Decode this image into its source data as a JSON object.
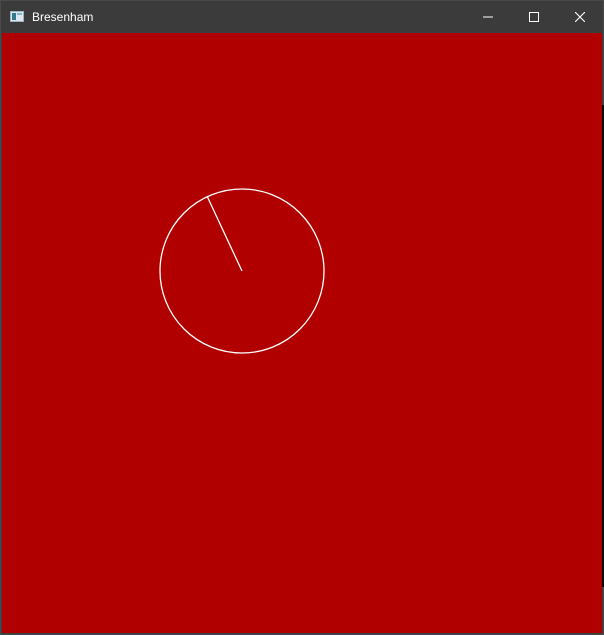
{
  "window": {
    "title": "Bresenham",
    "controls": {
      "minimize": "minimize-icon",
      "maximize": "maximize-icon",
      "close": "close-icon"
    }
  },
  "canvas": {
    "background_color": "#b00000",
    "stroke_color": "#ffffff",
    "shapes": [
      "circle",
      "radius-line"
    ]
  }
}
